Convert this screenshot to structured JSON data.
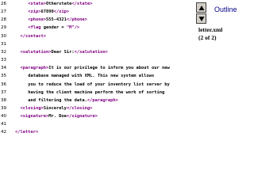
{
  "code": [
    {
      "num": "26",
      "parts": [
        [
          "i",
          "     "
        ],
        [
          "t",
          "<state>"
        ],
        [
          "v",
          "Otherstate"
        ],
        [
          "t",
          "</state>"
        ]
      ]
    },
    {
      "num": "27",
      "parts": [
        [
          "i",
          "     "
        ],
        [
          "t",
          "<zip>"
        ],
        [
          "v",
          "67890"
        ],
        [
          "t",
          "</zip>"
        ]
      ]
    },
    {
      "num": "28",
      "parts": [
        [
          "i",
          "     "
        ],
        [
          "t",
          "<phone>"
        ],
        [
          "v",
          "555-4321"
        ],
        [
          "t",
          "</phone>"
        ]
      ]
    },
    {
      "num": "29",
      "parts": [
        [
          "i",
          "     "
        ],
        [
          "t",
          "<flag"
        ],
        [
          "v",
          " gender = "
        ],
        [
          "t",
          "\"M\""
        ],
        [
          "t",
          "/>"
        ]
      ]
    },
    {
      "num": "30",
      "parts": [
        [
          "i",
          "  "
        ],
        [
          "t",
          "</contact>"
        ]
      ]
    },
    {
      "num": "31",
      "parts": []
    },
    {
      "num": "32",
      "parts": [
        [
          "i",
          "  "
        ],
        [
          "t",
          "<salutation>"
        ],
        [
          "v",
          "Dear Sir:"
        ],
        [
          "t",
          "</salutation>"
        ]
      ]
    },
    {
      "num": "33",
      "parts": []
    },
    {
      "num": "34",
      "parts": [
        [
          "i",
          "  "
        ],
        [
          "t",
          "<paragraph>"
        ],
        [
          "v",
          "It is our privilege to inform you about our new"
        ]
      ]
    },
    {
      "num": "35",
      "parts": [
        [
          "i",
          "     "
        ],
        [
          "v",
          "database managed with XML. This new system allows"
        ]
      ]
    },
    {
      "num": "36",
      "parts": [
        [
          "i",
          "     "
        ],
        [
          "v",
          "you to reduce the load of your inventory list server by"
        ]
      ]
    },
    {
      "num": "37",
      "parts": [
        [
          "i",
          "     "
        ],
        [
          "v",
          "having the client machine perform the work of sorting"
        ]
      ]
    },
    {
      "num": "38",
      "parts": [
        [
          "i",
          "     "
        ],
        [
          "v",
          "and filtering the data."
        ],
        [
          "t",
          "</paragraph>"
        ]
      ]
    },
    {
      "num": "39",
      "parts": [
        [
          "i",
          "  "
        ],
        [
          "t",
          "<closing>"
        ],
        [
          "v",
          "Sincerely"
        ],
        [
          "t",
          "</closing>"
        ]
      ]
    },
    {
      "num": "40",
      "parts": [
        [
          "i",
          "  "
        ],
        [
          "t",
          "<signature>"
        ],
        [
          "v",
          "Mr. Doe"
        ],
        [
          "t",
          "</signature>"
        ]
      ]
    },
    {
      "num": "41",
      "parts": []
    },
    {
      "num": "42",
      "parts": [
        [
          "t",
          "</letter>"
        ]
      ]
    }
  ],
  "nav": {
    "up_icon": "triangle-up-icon",
    "down_icon": "triangle-down-icon",
    "outline_label": "Outline"
  },
  "file": {
    "name": "letter.xml",
    "page": "(2 of 2)"
  },
  "colors": {
    "tag": "#800080",
    "text": "#000000",
    "outline": "#000080"
  }
}
